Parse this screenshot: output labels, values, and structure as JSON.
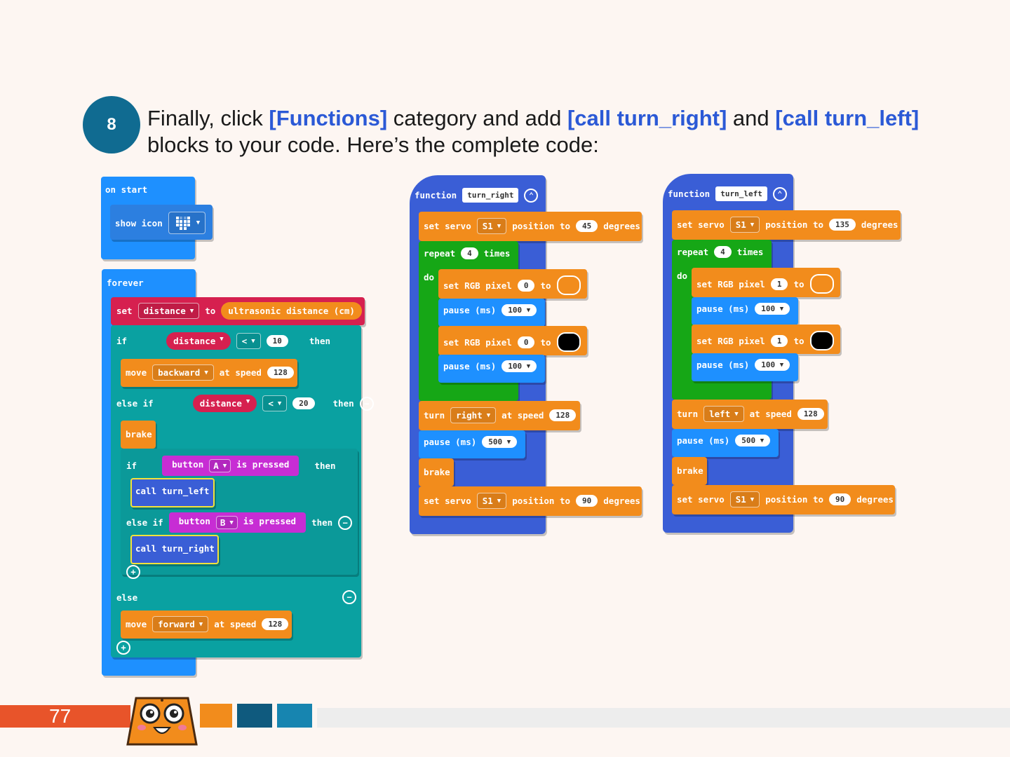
{
  "step": {
    "number": "8"
  },
  "instruction": {
    "part1": "Finally, click ",
    "functions": "[Functions]",
    "part2": " category and add ",
    "call_right": "[call turn_right]",
    "part3": " and ",
    "call_left": "[call turn_left]",
    "part4": " blocks to your code. Here’s the complete code:"
  },
  "on_start": {
    "header": "on start",
    "show_icon": "show icon"
  },
  "forever": {
    "header": "forever",
    "set": "set",
    "var": "distance",
    "to": "to",
    "sensor": "ultrasonic distance (cm)",
    "if": "if",
    "cmp_var": "distance",
    "op": "<",
    "val1": "10",
    "then": "then",
    "move": "move",
    "dir1": "backward",
    "at_speed": "at speed",
    "speed1": "128",
    "else_if": "else if",
    "val2": "20",
    "brake": "brake",
    "button": "button",
    "btnA": "A",
    "is_pressed": "is pressed",
    "call_left": "call turn_left",
    "btnB": "B",
    "call_right": "call turn_right",
    "else": "else",
    "dir2": "forward",
    "speed2": "128"
  },
  "func_right": {
    "header": "function",
    "name": "turn_right",
    "set_servo": "set servo",
    "servo": "S1",
    "position_to": "position to",
    "pos1": "45",
    "degrees": "degrees",
    "repeat": "repeat",
    "times_n": "4",
    "times": "times",
    "do": "do",
    "set_rgb": "set RGB pixel",
    "pix": "0",
    "to": "to",
    "pause": "pause (ms)",
    "pause_v": "100",
    "turn": "turn",
    "dir": "right",
    "at_speed": "at speed",
    "speed": "128",
    "pause2": "500",
    "brake": "brake",
    "pos2": "90"
  },
  "func_left": {
    "header": "function",
    "name": "turn_left",
    "set_servo": "set servo",
    "servo": "S1",
    "position_to": "position to",
    "pos1": "135",
    "degrees": "degrees",
    "repeat": "repeat",
    "times_n": "4",
    "times": "times",
    "do": "do",
    "set_rgb": "set RGB pixel",
    "pix": "1",
    "to": "to",
    "pause": "pause (ms)",
    "pause_v": "100",
    "turn": "turn",
    "dir": "left",
    "at_speed": "at speed",
    "speed": "128",
    "pause2": "500",
    "brake": "brake",
    "pos2": "90"
  },
  "footer": {
    "page": "77"
  },
  "colors": {
    "accent": "#2b59d6",
    "circle": "#106b91",
    "footer_red": "#e8542a"
  }
}
